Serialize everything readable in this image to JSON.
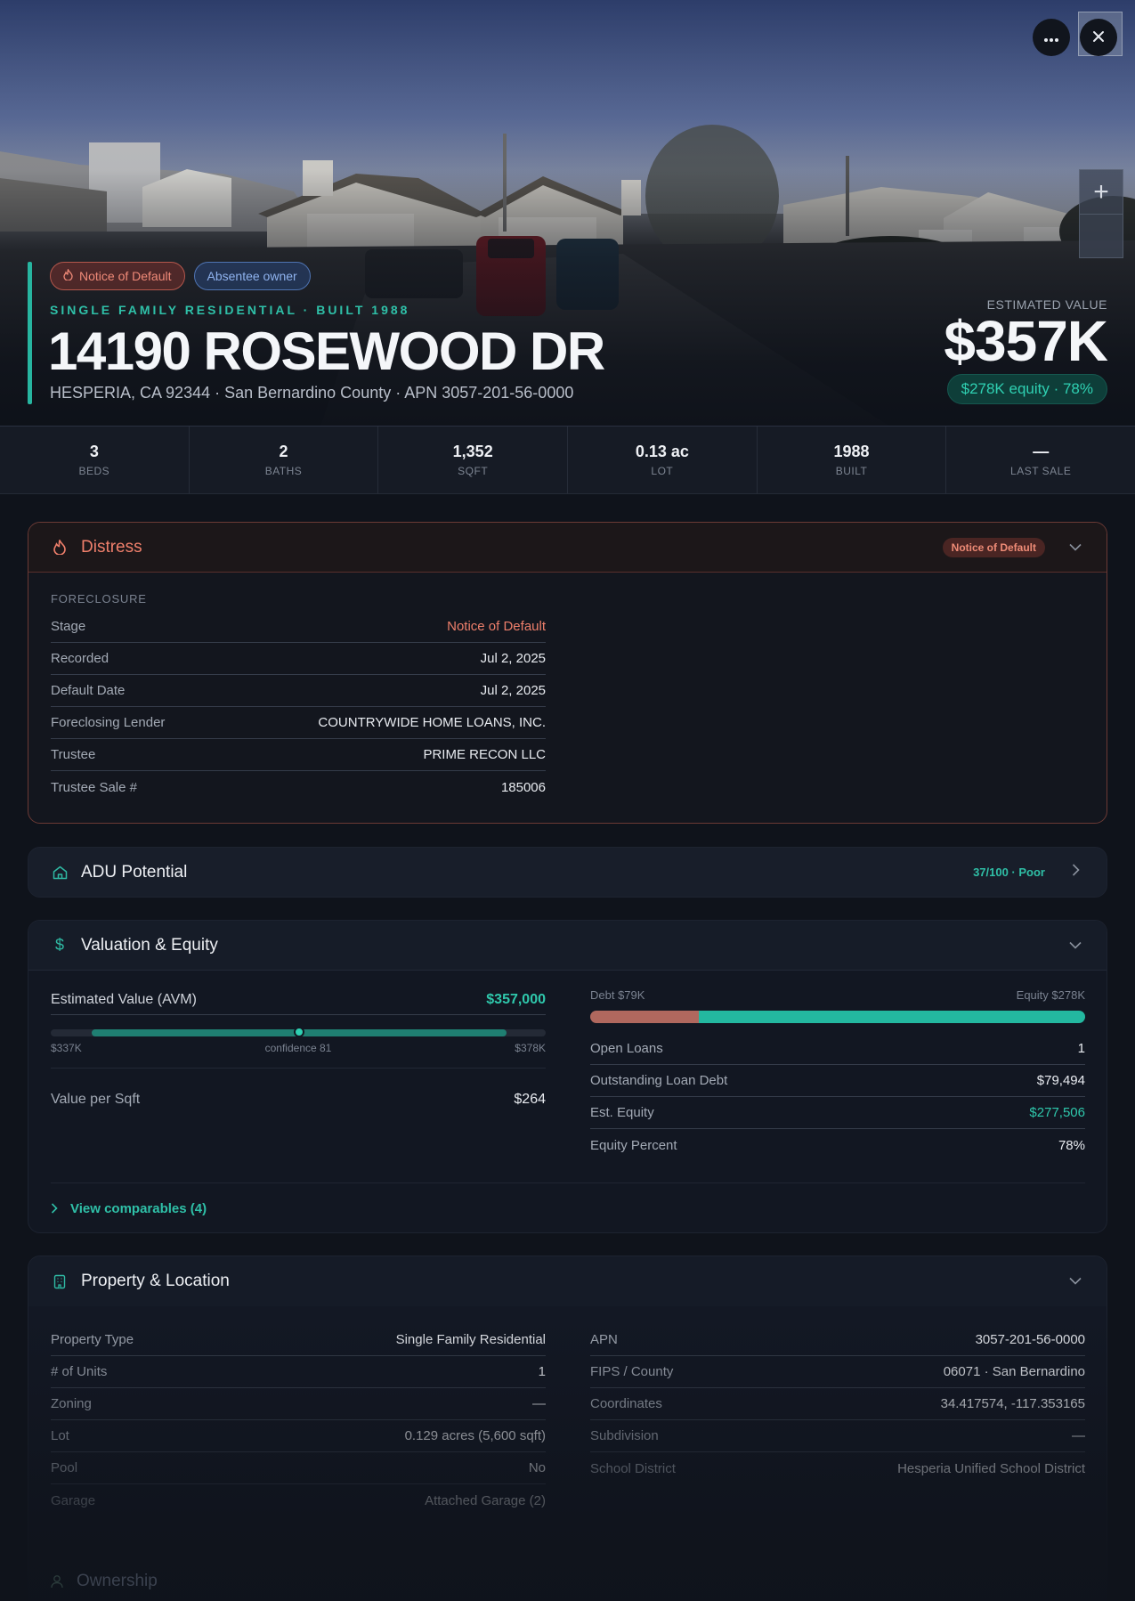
{
  "hero": {
    "badges": {
      "distress": "Notice of Default",
      "owner": "Absentee owner"
    },
    "eyebrow": "SINGLE FAMILY RESIDENTIAL · BUILT 1988",
    "street": "14190 ROSEWOOD DR",
    "subline": "HESPERIA, CA 92344 · San Bernardino County · APN 3057-201-56-0000",
    "estimated_label": "ESTIMATED VALUE",
    "estimated_value": "$357K",
    "equity_pill": "$278K equity · 78%",
    "icons": {
      "more": "more-icon",
      "close": "close-icon",
      "zoom_in": "plus-icon"
    }
  },
  "stats": [
    {
      "value": "3",
      "label": "BEDS"
    },
    {
      "value": "2",
      "label": "BATHS"
    },
    {
      "value": "1,352",
      "label": "SQFT"
    },
    {
      "value": "0.13 ac",
      "label": "LOT"
    },
    {
      "value": "1988",
      "label": "BUILT"
    },
    {
      "value": "—",
      "label": "LAST SALE"
    }
  ],
  "distress": {
    "title": "Distress",
    "badge": "Notice of Default",
    "section": "FORECLOSURE",
    "rows": [
      {
        "k": "Stage",
        "v": "Notice of Default"
      },
      {
        "k": "Recorded",
        "v": "Jul 2, 2025"
      },
      {
        "k": "Default Date",
        "v": "Jul 2, 2025"
      },
      {
        "k": "Foreclosing Lender",
        "v": "COUNTRYWIDE HOME LOANS, INC."
      },
      {
        "k": "Trustee",
        "v": "PRIME RECON LLC"
      },
      {
        "k": "Trustee Sale #",
        "v": "185006"
      }
    ]
  },
  "adu": {
    "title": "ADU Potential",
    "score": "37/100 · Poor"
  },
  "valuation": {
    "title": "Valuation & Equity",
    "avm_label": "Estimated Value (AVM)",
    "avm_value": "$357,000",
    "range_low": "$337K",
    "range_mid": "confidence 81",
    "range_high": "$378K",
    "value_per_sqft_label": "Value per Sqft",
    "value_per_sqft": "$264",
    "debt_label": "Debt $79K",
    "equity_label": "Equity $278K",
    "debt_fraction": 0.22,
    "rows": [
      {
        "k": "Open Loans",
        "v": "1"
      },
      {
        "k": "Outstanding Loan Debt",
        "v": "$79,494"
      },
      {
        "k": "Est. Equity",
        "v": "$277,506"
      },
      {
        "k": "Equity Percent",
        "v": "78%"
      }
    ],
    "comparables": "View comparables (4)"
  },
  "property": {
    "title": "Property & Location",
    "left": [
      {
        "k": "Property Type",
        "v": "Single Family Residential"
      },
      {
        "k": "# of Units",
        "v": "1"
      },
      {
        "k": "Zoning",
        "v": "—"
      },
      {
        "k": "Lot",
        "v": "0.129 acres (5,600 sqft)"
      },
      {
        "k": "Pool",
        "v": "No"
      },
      {
        "k": "Garage",
        "v": "Attached Garage (2)"
      }
    ],
    "right": [
      {
        "k": "APN",
        "v": "3057-201-56-0000"
      },
      {
        "k": "FIPS / County",
        "v": "06071 · San Bernardino"
      },
      {
        "k": "Coordinates",
        "v": "34.417574, -117.353165"
      },
      {
        "k": "Subdivision",
        "v": "—"
      },
      {
        "k": "School District",
        "v": "Hesperia Unified School District"
      }
    ]
  },
  "ownership": {
    "title": "Ownership"
  },
  "colors": {
    "accent": "#27b5a0",
    "distress": "#ef7f6b",
    "debt": "#b0685e",
    "equity": "#23b8a0"
  }
}
